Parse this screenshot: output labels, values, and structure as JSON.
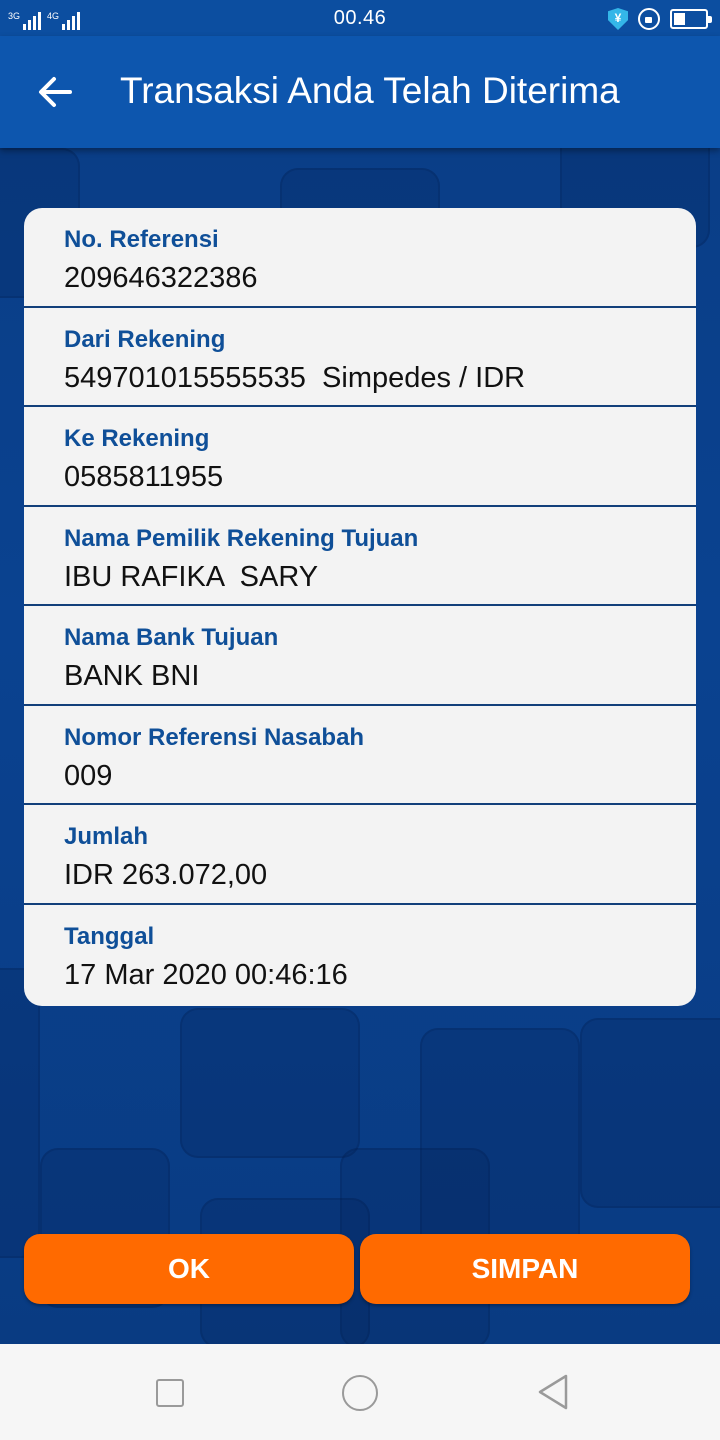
{
  "status_bar": {
    "time": "00.46",
    "network_1": "3G",
    "network_2": "4G",
    "battery_level": 0.35
  },
  "header": {
    "title": "Transaksi Anda Telah Diterima"
  },
  "details": [
    {
      "label": "No. Referensi",
      "value": "209646322386"
    },
    {
      "label": "Dari Rekening",
      "value": "549701015555535  Simpedes / IDR"
    },
    {
      "label": "Ke Rekening",
      "value": "0585811955"
    },
    {
      "label": "Nama Pemilik Rekening Tujuan",
      "value": "IBU RAFIKA  SARY"
    },
    {
      "label": "Nama Bank Tujuan",
      "value": "BANK BNI"
    },
    {
      "label": "Nomor Referensi Nasabah",
      "value": "009"
    },
    {
      "label": "Jumlah",
      "value": "IDR 263.072,00"
    },
    {
      "label": "Tanggal",
      "value": "17 Mar 2020 00:46:16"
    }
  ],
  "buttons": {
    "ok": "OK",
    "simpan": "SIMPAN"
  },
  "colors": {
    "header": "#0d56ae",
    "button": "#ff6a00",
    "label": "#0f4f98"
  }
}
